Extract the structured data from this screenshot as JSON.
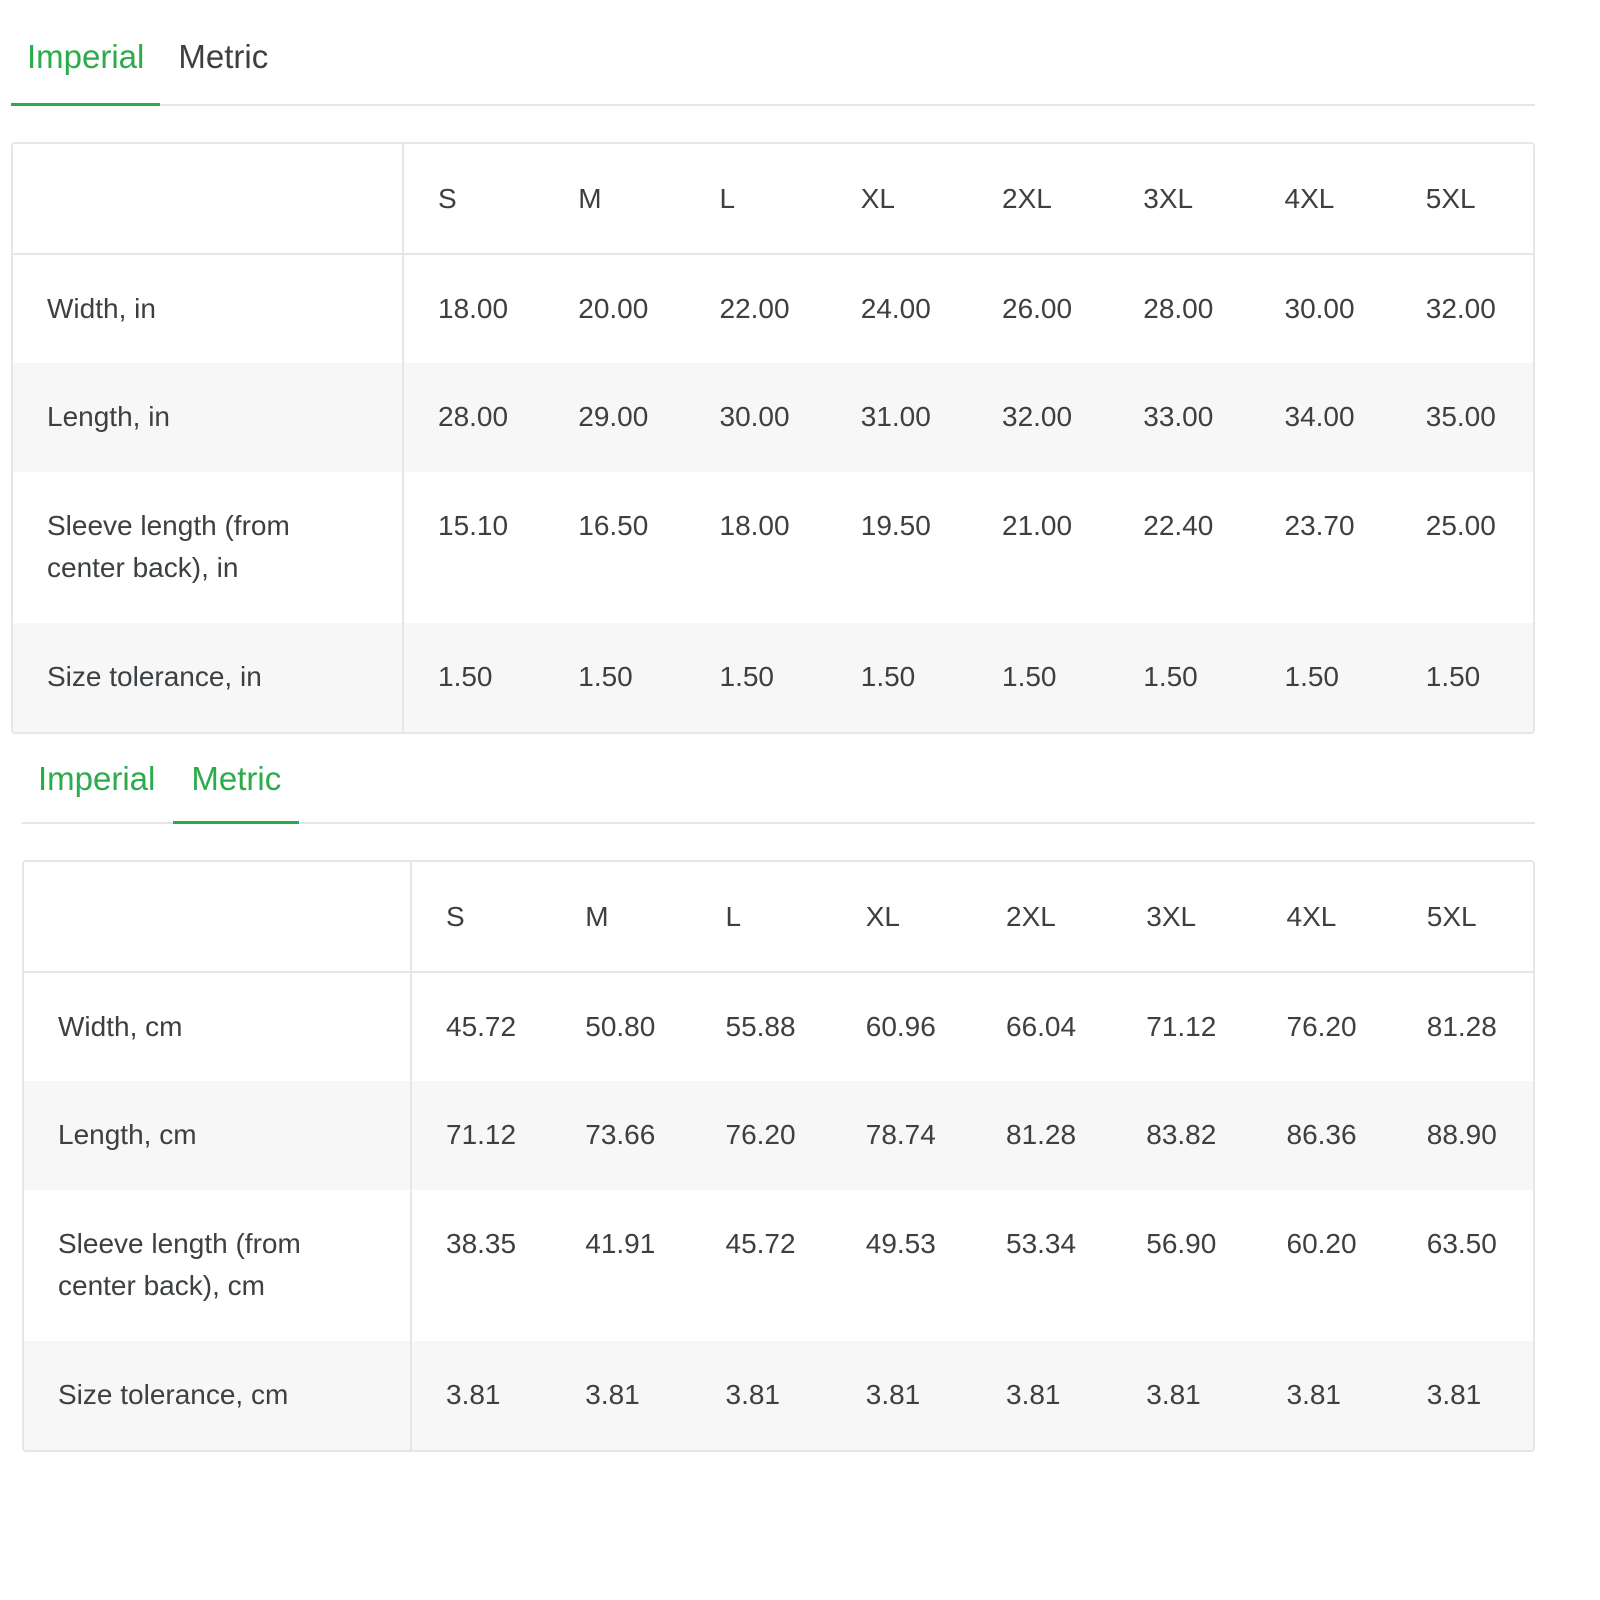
{
  "imperial_panel": {
    "tabs": [
      {
        "label": "Imperial",
        "active": true
      },
      {
        "label": "Metric",
        "active": false
      }
    ],
    "table": {
      "sizes": [
        "S",
        "M",
        "L",
        "XL",
        "2XL",
        "3XL",
        "4XL",
        "5XL"
      ],
      "rows": [
        {
          "label": "Width, in",
          "values": [
            "18.00",
            "20.00",
            "22.00",
            "24.00",
            "26.00",
            "28.00",
            "30.00",
            "32.00"
          ]
        },
        {
          "label": "Length, in",
          "values": [
            "28.00",
            "29.00",
            "30.00",
            "31.00",
            "32.00",
            "33.00",
            "34.00",
            "35.00"
          ]
        },
        {
          "label": "Sleeve length (from center back), in",
          "values": [
            "15.10",
            "16.50",
            "18.00",
            "19.50",
            "21.00",
            "22.40",
            "23.70",
            "25.00"
          ]
        },
        {
          "label": "Size tolerance, in",
          "values": [
            "1.50",
            "1.50",
            "1.50",
            "1.50",
            "1.50",
            "1.50",
            "1.50",
            "1.50"
          ]
        }
      ]
    }
  },
  "metric_panel": {
    "tabs": [
      {
        "label": "Imperial",
        "active": false
      },
      {
        "label": "Metric",
        "active": true
      }
    ],
    "table": {
      "sizes": [
        "S",
        "M",
        "L",
        "XL",
        "2XL",
        "3XL",
        "4XL",
        "5XL"
      ],
      "rows": [
        {
          "label": "Width, cm",
          "values": [
            "45.72",
            "50.80",
            "55.88",
            "60.96",
            "66.04",
            "71.12",
            "76.20",
            "81.28"
          ]
        },
        {
          "label": "Length, cm",
          "values": [
            "71.12",
            "73.66",
            "76.20",
            "78.74",
            "81.28",
            "83.82",
            "86.36",
            "88.90"
          ]
        },
        {
          "label": "Sleeve length (from center back), cm",
          "values": [
            "38.35",
            "41.91",
            "45.72",
            "49.53",
            "53.34",
            "56.90",
            "60.20",
            "63.50"
          ]
        },
        {
          "label": "Size tolerance, cm",
          "values": [
            "3.81",
            "3.81",
            "3.81",
            "3.81",
            "3.81",
            "3.81",
            "3.81",
            "3.81"
          ]
        }
      ]
    }
  },
  "colors": {
    "accent": "#2bab4a",
    "text": "#3c4043",
    "border": "#e6e6e6",
    "stripe": "#f7f7f7"
  }
}
